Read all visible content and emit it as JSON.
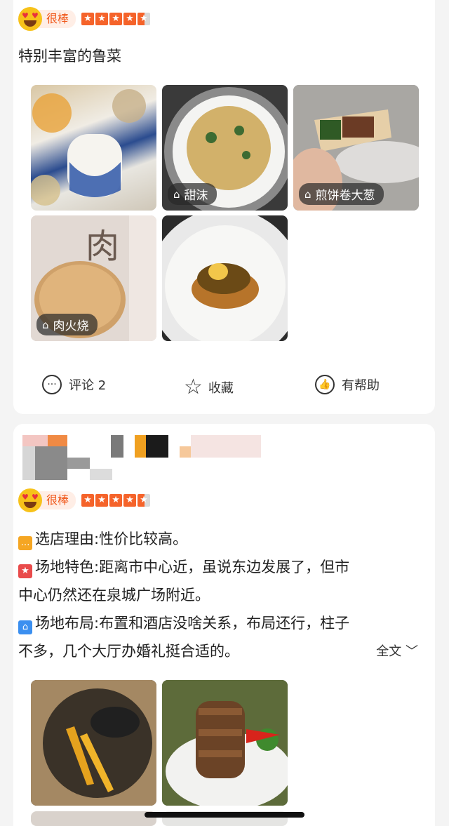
{
  "review1": {
    "rating_label": "很棒",
    "stars": 4.5,
    "text": "特别丰富的鲁菜",
    "photos": [
      {
        "tag": ""
      },
      {
        "tag": "甜沫"
      },
      {
        "tag": "煎饼卷大葱"
      },
      {
        "tag": "肉火烧"
      },
      {
        "tag": ""
      }
    ],
    "actions": {
      "comment_label": "评论 2",
      "collect_label": "收藏",
      "helpful_label": "有帮助"
    }
  },
  "review2": {
    "rating_label": "很棒",
    "stars": 4.5,
    "reason_text": "选店理由:性价比较高。",
    "feature_line1": "场地特色:距离市中心近，虽说东边发展了，但市",
    "feature_line2": "中心仍然还在泉城广场附近。",
    "layout_line1": "场地布局:布置和酒店没啥关系，布局还行，柱子",
    "layout_line2": "不多，几个大厅办婚礼挺合适的。",
    "more_label": "全文"
  },
  "colors": {
    "accent": "#f5632a",
    "badge_bg": "#ffeee6"
  },
  "icons": [
    "heart-eyes-emoji",
    "star-icon",
    "comment-icon",
    "collect-star-icon",
    "thumbs-up-icon",
    "tag-icon",
    "chevron-down-icon"
  ]
}
